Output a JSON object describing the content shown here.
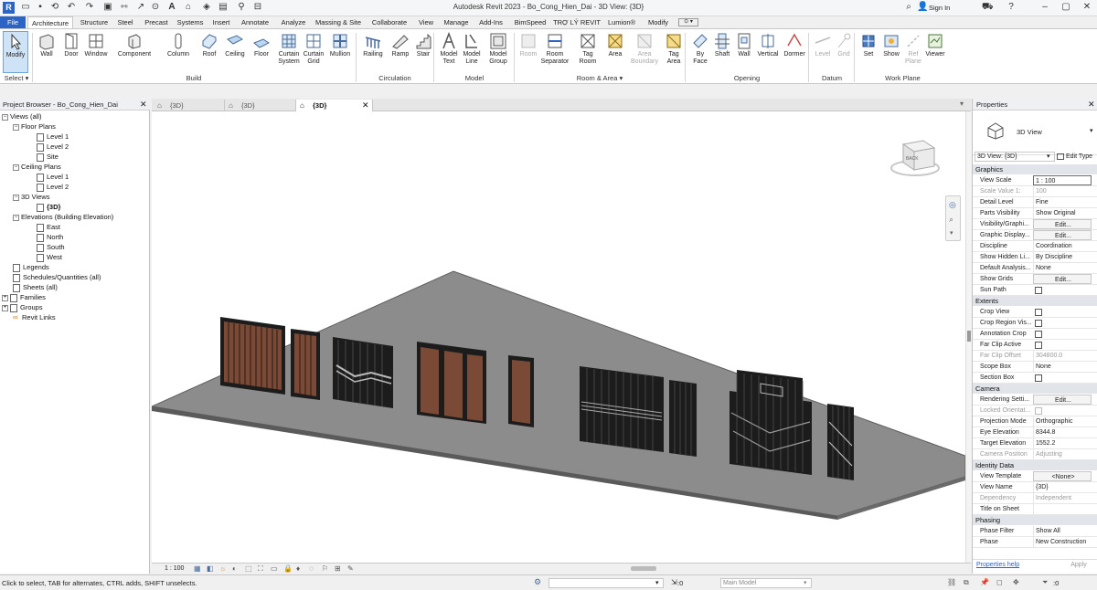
{
  "window": {
    "title": "Autodesk Revit 2023 - Bo_Cong_Hien_Dai - 3D View: {3D}",
    "sign_in": "Sign In"
  },
  "ribbon_tabs": [
    "File",
    "Architecture",
    "Structure",
    "Steel",
    "Precast",
    "Systems",
    "Insert",
    "Annotate",
    "Analyze",
    "Massing & Site",
    "Collaborate",
    "View",
    "Manage",
    "Add-Ins",
    "BimSpeed",
    "TRỢ LÝ REVIT",
    "Lumion®",
    "Modify"
  ],
  "ribbon_active_tab": "Architecture",
  "tools": {
    "modify": "Modify",
    "wall": "Wall",
    "door": "Door",
    "window": "Window",
    "component": "Component",
    "column": "Column",
    "roof": "Roof",
    "ceiling": "Ceiling",
    "floor": "Floor",
    "curtain_system": "Curtain\nSystem",
    "curtain_grid": "Curtain\nGrid",
    "mullion": "Mullion",
    "railing": "Railing",
    "ramp": "Ramp",
    "stair": "Stair",
    "model_text": "Model\nText",
    "model_line": "Model\nLine",
    "model_group": "Model\nGroup",
    "room": "Room",
    "room_separator": "Room\nSeparator",
    "tag_room": "Tag\nRoom",
    "area": "Area",
    "area_boundary": "Area\nBoundary",
    "tag_area": "Tag\nArea",
    "by_face": "By\nFace",
    "shaft": "Shaft",
    "wall_opening": "Wall",
    "vertical": "Vertical",
    "dormer": "Dormer",
    "level": "Level",
    "grid": "Grid",
    "set": "Set",
    "show": "Show",
    "ref_plane": "Ref\nPlane",
    "viewer": "Viewer"
  },
  "panels": {
    "select": "Select ▾",
    "build": "Build",
    "circulation": "Circulation",
    "model": "Model",
    "room_area": "Room & Area ▾",
    "opening": "Opening",
    "datum": "Datum",
    "work_plane": "Work Plane"
  },
  "project_browser": {
    "title": "Project Browser - Bo_Cong_Hien_Dai",
    "tree": {
      "views_all": "Views (all)",
      "floor_plans": "Floor Plans",
      "fp_level1": "Level 1",
      "fp_level2": "Level 2",
      "fp_site": "Site",
      "ceiling_plans": "Ceiling Plans",
      "cp_level1": "Level 1",
      "cp_level2": "Level 2",
      "views_3d": "3D Views",
      "view_3d": "{3D}",
      "elevations": "Elevations (Building Elevation)",
      "east": "East",
      "north": "North",
      "south": "South",
      "west": "West",
      "legends": "Legends",
      "schedules": "Schedules/Quantities (all)",
      "sheets": "Sheets (all)",
      "families": "Families",
      "groups": "Groups",
      "revit_links": "Revit Links"
    }
  },
  "view_tabs": [
    "{3D}",
    "{3D}",
    "{3D}"
  ],
  "viewcube_label": "BACK",
  "view_scale_label": "1 : 100",
  "properties": {
    "title": "Properties",
    "type_name": "3D View",
    "selector": "3D View: {3D}",
    "edit_type": "Edit Type",
    "groups": {
      "graphics": "Graphics",
      "extents": "Extents",
      "camera": "Camera",
      "identity": "Identity Data",
      "phasing": "Phasing"
    },
    "rows": {
      "view_scale_k": "View Scale",
      "view_scale_v": "1 : 100",
      "scale_value_k": "Scale Value  1:",
      "scale_value_v": "100",
      "detail_level_k": "Detail Level",
      "detail_level_v": "Fine",
      "parts_vis_k": "Parts Visibility",
      "parts_vis_v": "Show Original",
      "vis_graphics_k": "Visibility/Graphi...",
      "vis_graphics_v": "Edit...",
      "graphic_display_k": "Graphic Display...",
      "graphic_display_v": "Edit...",
      "discipline_k": "Discipline",
      "discipline_v": "Coordination",
      "show_hidden_k": "Show Hidden Li...",
      "show_hidden_v": "By Discipline",
      "default_analysis_k": "Default Analysis...",
      "default_analysis_v": "None",
      "show_grids_k": "Show Grids",
      "show_grids_v": "Edit...",
      "sun_path_k": "Sun Path",
      "crop_view_k": "Crop View",
      "crop_region_k": "Crop Region Vis...",
      "annotation_crop_k": "Annotation Crop",
      "far_clip_active_k": "Far Clip Active",
      "far_clip_offset_k": "Far Clip Offset",
      "far_clip_offset_v": "304800.0",
      "scope_box_k": "Scope Box",
      "scope_box_v": "None",
      "section_box_k": "Section Box",
      "rendering_k": "Rendering Setti...",
      "rendering_v": "Edit...",
      "locked_k": "Locked Orientat...",
      "projection_k": "Projection Mode",
      "projection_v": "Orthographic",
      "eye_k": "Eye Elevation",
      "eye_v": "8344.8",
      "target_k": "Target Elevation",
      "target_v": "1552.2",
      "cam_pos_k": "Camera Position",
      "cam_pos_v": "Adjusting",
      "view_template_k": "View Template",
      "view_template_v": "<None>",
      "view_name_k": "View Name",
      "view_name_v": "{3D}",
      "dependency_k": "Dependency",
      "dependency_v": "Independent",
      "title_sheet_k": "Title on Sheet",
      "phase_filter_k": "Phase Filter",
      "phase_filter_v": "Show All",
      "phase_k": "Phase",
      "phase_v": "New Construction"
    },
    "help": "Properties help",
    "apply": "Apply"
  },
  "status": {
    "message": "Click to select, TAB for alternates, CTRL adds, SHIFT unselects.",
    "counter": ":0",
    "main_model": "Main Model",
    "filter_count": ":0"
  },
  "colors": {
    "ribbon_blue": "#2b64c4",
    "ground": "#8c8c8c",
    "ground_edge": "#5a5a5a",
    "gate_black": "#1c1c1c",
    "gate_wood": "#7a4a36"
  }
}
